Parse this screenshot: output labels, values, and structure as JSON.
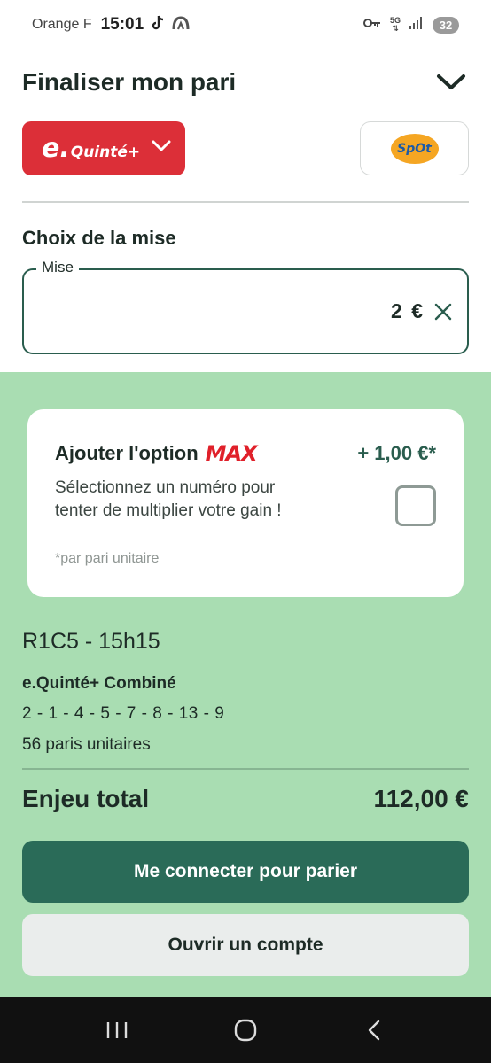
{
  "status_bar": {
    "carrier": "Orange F",
    "time": "15:01",
    "network": "5G",
    "battery": "32"
  },
  "header": {
    "title": "Finaliser mon pari"
  },
  "bet_type": {
    "brand_prefix": "e.",
    "brand_name": "Quinté+"
  },
  "spot": {
    "logo_text": "SpOt"
  },
  "stake": {
    "section_title": "Choix de la mise",
    "field_label": "Mise",
    "value": "2 €"
  },
  "max_option": {
    "title": "Ajouter l'option",
    "logo_text": "MAX",
    "price": "+ 1,00 €*",
    "description": "Sélectionnez un numéro pour tenter de multiplier votre gain !",
    "note": "*par pari unitaire"
  },
  "summary": {
    "race": "R1C5 - 15h15",
    "bet_name": "e.Quinté+ Combiné",
    "selection": "2 - 1 - 4 - 5 - 7 - 8 - 13 - 9",
    "count": "56 paris unitaires",
    "total_label": "Enjeu total",
    "total_value": "112,00 €"
  },
  "actions": {
    "login_label": "Me connecter pour parier",
    "signup_label": "Ouvrir un compte"
  },
  "colors": {
    "brand_red": "#dc2f38",
    "primary_green": "#2a6b58",
    "panel_green": "#a9ddb2"
  }
}
